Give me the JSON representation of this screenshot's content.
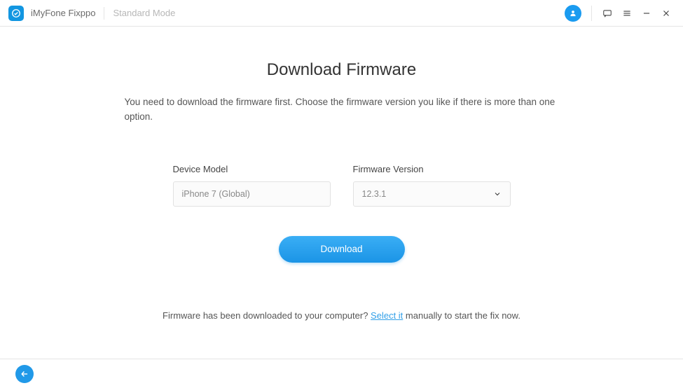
{
  "titlebar": {
    "app_name": "iMyFone Fixppo",
    "mode_label": "Standard Mode"
  },
  "page": {
    "title": "Download Firmware",
    "instructions": "You need to download the firmware first. Choose the firmware version you like if there is more than one option."
  },
  "form": {
    "device_label": "Device Model",
    "device_value": "iPhone 7 (Global)",
    "firmware_label": "Firmware Version",
    "firmware_value": "12.3.1",
    "download_label": "Download"
  },
  "hint": {
    "prefix": "Firmware has been downloaded to your computer? ",
    "link": "Select it",
    "suffix": " manually to start the fix now."
  }
}
